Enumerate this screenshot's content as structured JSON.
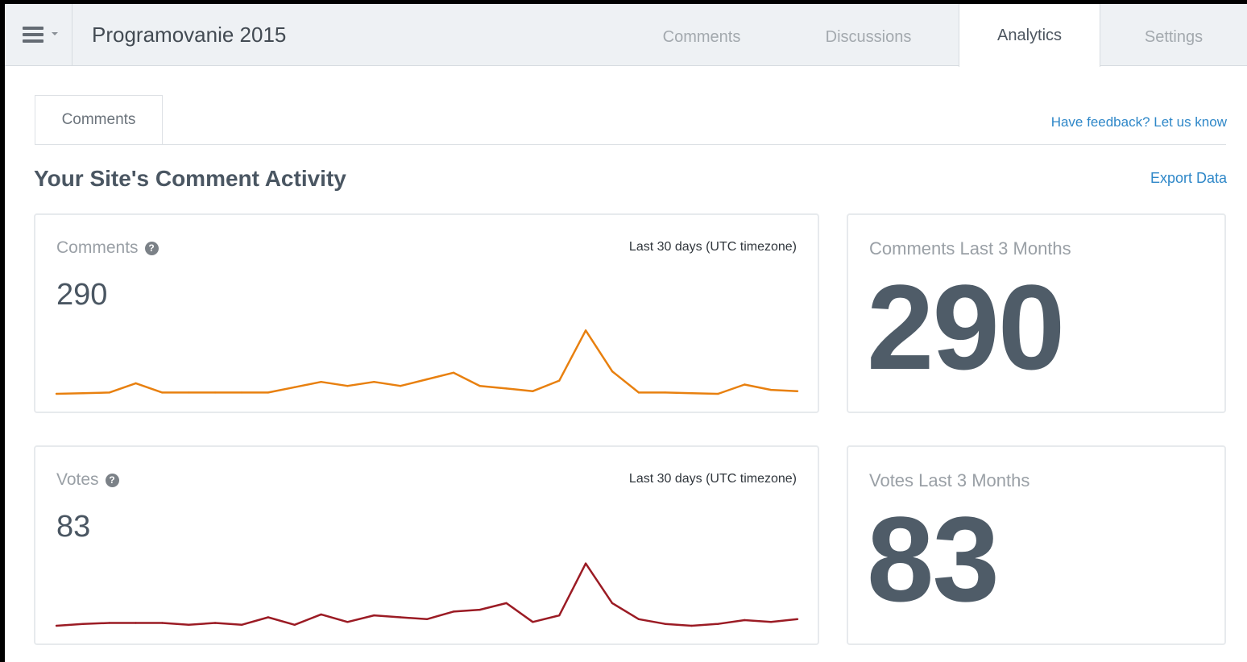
{
  "header": {
    "site_title": "Programovanie 2015",
    "tabs": [
      {
        "label": "Comments",
        "active": false
      },
      {
        "label": "Discussions",
        "active": false
      },
      {
        "label": "Analytics",
        "active": true
      },
      {
        "label": "Settings",
        "active": false
      }
    ]
  },
  "subnav": {
    "tab_label": "Comments",
    "feedback_link": "Have feedback? Let us know"
  },
  "section": {
    "title": "Your Site's Comment Activity",
    "export_link": "Export Data"
  },
  "icons": {
    "menu": "hamburger-menu-icon",
    "help": "question-circle-icon"
  },
  "colors": {
    "comments_line": "#e8800f",
    "votes_line": "#9b1b24",
    "link": "#2e87c8"
  },
  "comments_card": {
    "title": "Comments",
    "help_glyph": "?",
    "range": "Last 30 days (UTC timezone)",
    "value": "290"
  },
  "comments_summary": {
    "title": "Comments Last 3 Months",
    "value": "290"
  },
  "votes_card": {
    "title": "Votes",
    "help_glyph": "?",
    "range": "Last 30 days (UTC timezone)",
    "value": "83"
  },
  "votes_summary": {
    "title": "Votes Last 3 Months",
    "value": "83"
  },
  "chart_data": [
    {
      "type": "line",
      "series": [
        {
          "values": [
            0,
            0.5,
            1,
            8,
            1,
            1,
            1,
            1,
            1,
            5,
            9,
            6,
            9,
            6,
            11,
            16,
            6,
            4,
            2,
            10,
            48,
            17,
            1,
            1,
            0.5,
            0,
            7,
            3,
            2
          ]
        }
      ],
      "ylim": [
        0,
        50
      ],
      "grid": false
    },
    {
      "type": "line",
      "series": [
        {
          "values": [
            0,
            1,
            1.5,
            1.5,
            1.5,
            0.5,
            1.5,
            0.5,
            4.5,
            0.5,
            6,
            2,
            5.5,
            4.5,
            3.5,
            7.5,
            8.5,
            12,
            2,
            5.5,
            33,
            12,
            3.5,
            1,
            0,
            1,
            3,
            2,
            3.5
          ]
        }
      ],
      "ylim": [
        0,
        35
      ],
      "grid": false
    }
  ]
}
